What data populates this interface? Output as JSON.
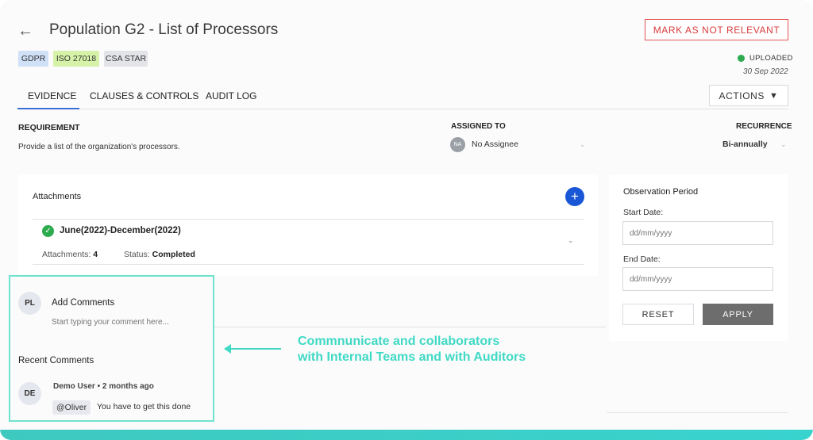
{
  "header": {
    "title": "Population G2 - List of Processors",
    "mark_button": "MARK AS NOT RELEVANT",
    "badges": [
      {
        "label": "GDPR",
        "color": "#cfe0f7"
      },
      {
        "label": "ISO 27018",
        "color": "#d6f2a8"
      },
      {
        "label": "CSA STAR",
        "color": "#e3e4e8"
      }
    ],
    "status": "UPLOADED",
    "status_color": "#2eaa4f",
    "date": "30 Sep 2022"
  },
  "tabs": [
    "EVIDENCE",
    "CLAUSES & CONTROLS",
    "AUDIT LOG"
  ],
  "actions_label": "ACTIONS",
  "requirement": {
    "label": "REQUIREMENT",
    "text": "Provide a list of the organization's processors."
  },
  "assigned": {
    "label": "ASSIGNED TO",
    "initials": "NA",
    "value": "No Assignee"
  },
  "recurrence": {
    "label": "RECURRENCE",
    "value": "Bi-annually"
  },
  "attachments": {
    "title": "Attachments",
    "period": "June(2022)-December(2022)",
    "count_label": "Attachments:",
    "count": "4",
    "status_label": "Status:",
    "status": "Completed"
  },
  "observation": {
    "title": "Observation Period",
    "start_label": "Start Date:",
    "start_placeholder": "dd/mm/yyyy",
    "end_label": "End Date:",
    "end_placeholder": "dd/mm/yyyy",
    "reset": "RESET",
    "apply": "APPLY"
  },
  "comments": {
    "user_initials": "PL",
    "add_title": "Add Comments",
    "placeholder": "Start typing your comment here...",
    "recent_title": "Recent Comments",
    "items": [
      {
        "initials": "DE",
        "author": "Demo User • 2 months ago",
        "mention": "@Oliver",
        "text": "You have to get this done"
      }
    ]
  },
  "callout": {
    "line1": "Commnunicate and collaborators",
    "line2": "with Internal Teams and with Auditors",
    "color": "#3fd9c4"
  }
}
